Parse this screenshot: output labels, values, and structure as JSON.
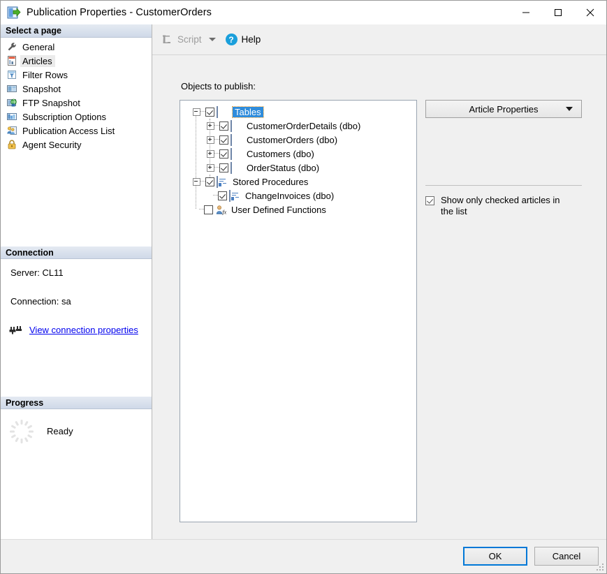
{
  "window": {
    "title": "Publication Properties - CustomerOrders",
    "icon": "publication-properties-icon",
    "minimize_label": "—",
    "maximize_label": "☐",
    "close_label": "✕"
  },
  "sidebar": {
    "select_page_header": "Select a page",
    "items": [
      {
        "label": "General",
        "icon": "wrench-icon",
        "selected": false
      },
      {
        "label": "Articles",
        "icon": "articles-icon",
        "selected": true
      },
      {
        "label": "Filter Rows",
        "icon": "filter-rows-icon",
        "selected": false
      },
      {
        "label": "Snapshot",
        "icon": "snapshot-icon",
        "selected": false
      },
      {
        "label": "FTP Snapshot",
        "icon": "ftp-snapshot-icon",
        "selected": false
      },
      {
        "label": "Subscription Options",
        "icon": "subscription-options-icon",
        "selected": false
      },
      {
        "label": "Publication Access List",
        "icon": "publication-access-list-icon",
        "selected": false
      },
      {
        "label": "Agent Security",
        "icon": "agent-security-icon",
        "selected": false
      }
    ],
    "connection": {
      "header": "Connection",
      "server": "Server: CL11",
      "connection": "Connection: sa",
      "link": "View connection properties",
      "link_icon": "connection-plug-icon"
    },
    "progress": {
      "header": "Progress",
      "status": "Ready",
      "spinner_icon": "progress-spinner-icon"
    }
  },
  "toolbar": {
    "script_label": "Script",
    "script_icon": "script-icon",
    "script_disabled": true,
    "help_label": "Help",
    "help_icon": "help-icon"
  },
  "main": {
    "objects_label": "Objects to publish:",
    "tree": [
      {
        "label": "Tables",
        "level": 0,
        "expander": "minus",
        "checked": true,
        "icon": "table-icon",
        "selected": true
      },
      {
        "label": "CustomerOrderDetails (dbo)",
        "level": 1,
        "expander": "plus",
        "checked": true,
        "icon": "table-icon",
        "selected": false
      },
      {
        "label": "CustomerOrders (dbo)",
        "level": 1,
        "expander": "plus",
        "checked": true,
        "icon": "table-icon",
        "selected": false
      },
      {
        "label": "Customers (dbo)",
        "level": 1,
        "expander": "plus",
        "checked": true,
        "icon": "table-icon",
        "selected": false
      },
      {
        "label": "OrderStatus (dbo)",
        "level": 1,
        "expander": "plus",
        "checked": true,
        "icon": "table-icon",
        "selected": false
      },
      {
        "label": "Stored Procedures",
        "level": 0,
        "expander": "minus",
        "checked": true,
        "icon": "stored-procedure-icon",
        "selected": false
      },
      {
        "label": "ChangeInvoices (dbo)",
        "level": 1,
        "expander": "none",
        "checked": true,
        "icon": "stored-procedure-icon",
        "selected": false
      },
      {
        "label": "User Defined Functions",
        "level": 0,
        "expander": "none",
        "checked": false,
        "icon": "user-defined-function-icon",
        "selected": false
      }
    ],
    "article_properties_button": "Article Properties",
    "show_only_checked_label": "Show only checked articles in the list",
    "show_only_checked": true
  },
  "footer": {
    "ok_label": "OK",
    "cancel_label": "Cancel"
  },
  "colors": {
    "accent": "#0078d7",
    "selection": "#2f8cdb",
    "link": "#0000ee",
    "help_blue": "#1a9fdb",
    "section_header": "#cfd9e8"
  }
}
